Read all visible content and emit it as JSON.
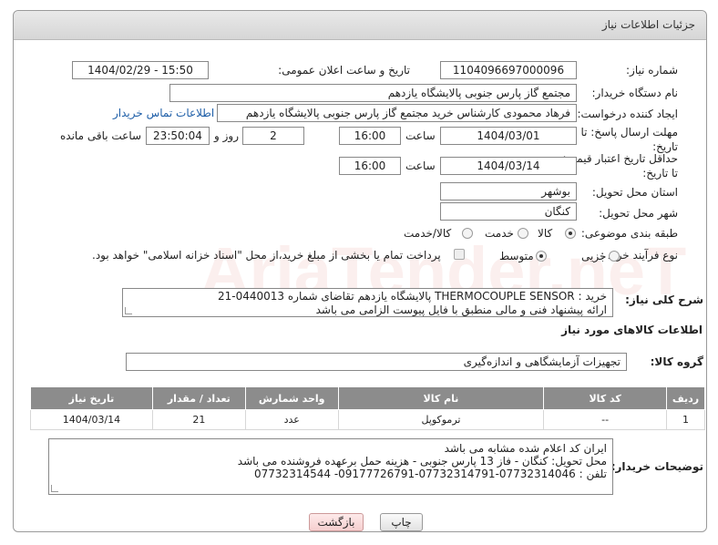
{
  "header": {
    "title": "جزئیات اطلاعات نیاز"
  },
  "form": {
    "need_number_label": "شماره نیاز:",
    "need_number": "1104096697000096",
    "announce_label": "تاریخ و ساعت اعلان عمومی:",
    "announce_value": "1404/02/29 - 15:50",
    "buyer_org_label": "نام دستگاه خریدار:",
    "buyer_org": "مجتمع گاز پارس جنوبی  پالایشگاه یازدهم",
    "creator_label": "ایجاد کننده درخواست:",
    "creator": "فرهاد محمودی کارشناس خرید مجتمع گاز پارس جنوبی  پالایشگاه یازدهم",
    "contact_link": "اطلاعات تماس خریدار",
    "reply_deadline_label": "مهلت ارسال پاسخ: تا تاریخ:",
    "reply_date": "1404/03/01",
    "time_label": "ساعت",
    "reply_time": "16:00",
    "days_value": "2",
    "days_label": "روز و",
    "remaining_time": "23:50:04",
    "remaining_label": "ساعت باقی مانده",
    "price_deadline_label": "حداقل تاریخ اعتبار قیمت: تا تاریخ:",
    "price_date": "1404/03/14",
    "price_time": "16:00",
    "province_label": "استان محل تحویل:",
    "province": "بوشهر",
    "city_label": "شهر محل تحویل:",
    "city": "کنگان",
    "category_label": "طبقه بندی موضوعی:",
    "category_options": [
      "کالا",
      "خدمت",
      "کالا/خدمت"
    ],
    "process_label": "نوع فرآیند خرید :",
    "process_options": [
      "جزیی",
      "متوسط"
    ],
    "payment_note": "پرداخت تمام یا بخشی از مبلغ خرید،از محل \"اسناد خزانه اسلامی\" خواهد بود."
  },
  "description": {
    "label": "شرح کلی نیاز:",
    "line1": "خرید :  THERMOCOUPLE SENSOR   پالایشگاه یازدهم تقاضای شماره 0440013-21",
    "line2": "ارائه پیشنهاد فنی و مالی منطبق با فایل پیوست الزامی می باشد"
  },
  "goods_section": {
    "title": "اطلاعات کالاهای مورد نیاز",
    "group_label": "گروه کالا:",
    "group_value": "تجهیزات آزمایشگاهی و اندازه‌گیری"
  },
  "table": {
    "headers": [
      "ردیف",
      "کد کالا",
      "نام کالا",
      "واحد شمارش",
      "تعداد / مقدار",
      "تاریخ نیاز"
    ],
    "rows": [
      [
        "1",
        "--",
        "ترموکوپل",
        "عدد",
        "21",
        "1404/03/14"
      ]
    ]
  },
  "buyer_notes": {
    "label": "توضیحات خریدار:",
    "line1": "ایران کد اعلام شده مشابه می باشد",
    "line2": "محل تحویل: کنگان - فاز 13 پارس جنوبی - هزینه حمل برعهده فروشنده می باشد",
    "line3": "تلفن : 07732314046-07732314791-09177726791- 07732314544"
  },
  "buttons": {
    "print": "چاپ",
    "back": "بازگشت"
  },
  "watermark": "AriaTender.neT",
  "colors": {
    "header_bg": "#dcdcdc",
    "table_header": "#8c8c8c",
    "link": "#1f5fa8",
    "back_button_bg": "#fbe1e1"
  }
}
